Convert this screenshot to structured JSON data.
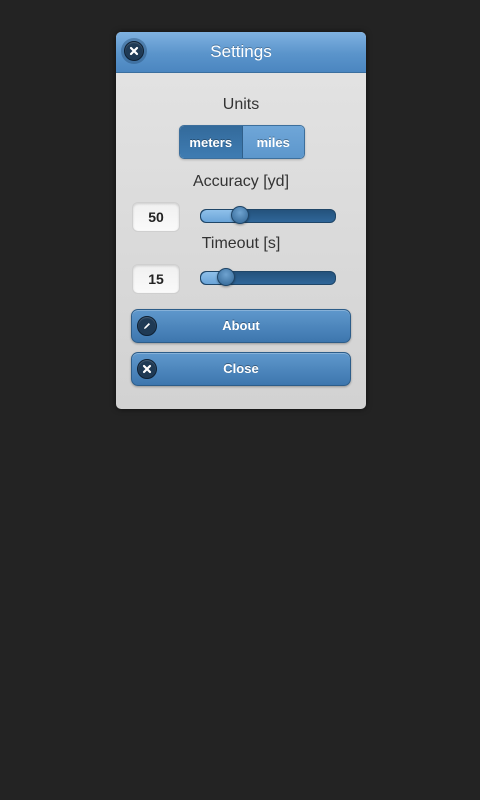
{
  "dialog": {
    "title": "Settings",
    "close_icon": "close-icon"
  },
  "units": {
    "label": "Units",
    "options": [
      "meters",
      "miles"
    ],
    "selected": "meters"
  },
  "accuracy": {
    "label": "Accuracy [yd]",
    "value": "50",
    "slider_fraction": 0.29
  },
  "timeout": {
    "label": "Timeout [s]",
    "value": "15",
    "slider_fraction": 0.19
  },
  "buttons": {
    "about": {
      "label": "About",
      "icon": "pencil-icon"
    },
    "close": {
      "label": "Close",
      "icon": "close-icon"
    }
  },
  "colors": {
    "accent": "#4b86c0",
    "background": "#232323"
  }
}
